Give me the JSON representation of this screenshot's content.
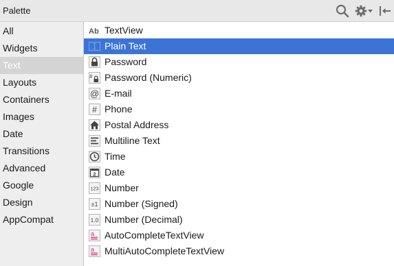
{
  "header": {
    "title": "Palette",
    "icons": [
      "search-icon",
      "gear-icon",
      "chevron-down-icon",
      "collapse-panel-icon"
    ]
  },
  "sidebar": {
    "selected_index": 2,
    "items": [
      {
        "label": "All"
      },
      {
        "label": "Widgets"
      },
      {
        "label": "Text"
      },
      {
        "label": "Layouts"
      },
      {
        "label": "Containers"
      },
      {
        "label": "Images"
      },
      {
        "label": "Date"
      },
      {
        "label": "Transitions"
      },
      {
        "label": "Advanced"
      },
      {
        "label": "Google"
      },
      {
        "label": "Design"
      },
      {
        "label": "AppCompat"
      }
    ]
  },
  "widgets": {
    "selected_index": 1,
    "items": [
      {
        "label": "TextView",
        "icon": "textview-icon",
        "glyph": "Ab"
      },
      {
        "label": "Plain Text",
        "icon": "plain-text-icon",
        "glyph": "I"
      },
      {
        "label": "Password",
        "icon": "lock-icon",
        "glyph": ""
      },
      {
        "label": "Password (Numeric)",
        "icon": "numeric-lock-icon",
        "glyph": "#"
      },
      {
        "label": "E-mail",
        "icon": "at-sign-icon",
        "glyph": "@"
      },
      {
        "label": "Phone",
        "icon": "hash-icon",
        "glyph": "#"
      },
      {
        "label": "Postal Address",
        "icon": "home-icon",
        "glyph": ""
      },
      {
        "label": "Multiline Text",
        "icon": "multiline-icon",
        "glyph": ""
      },
      {
        "label": "Time",
        "icon": "clock-icon",
        "glyph": ""
      },
      {
        "label": "Date",
        "icon": "calendar-icon",
        "glyph": "2"
      },
      {
        "label": "Number",
        "icon": "number-icon",
        "glyph": "123"
      },
      {
        "label": "Number (Signed)",
        "icon": "signed-number-icon",
        "glyph": "±1"
      },
      {
        "label": "Number (Decimal)",
        "icon": "decimal-number-icon",
        "glyph": "1.0"
      },
      {
        "label": "AutoCompleteTextView",
        "icon": "autocomplete-icon",
        "glyph": "a"
      },
      {
        "label": "MultiAutoCompleteTextView",
        "icon": "multi-autocomplete-icon",
        "glyph": "a"
      }
    ]
  },
  "colors": {
    "selection": "#3c74d6",
    "header_bg": "#e8e8e8",
    "sidebar_bg": "#eeeeee",
    "sidebar_selected_bg": "#d4d4d4",
    "autocomplete_accent": "#d0307a"
  }
}
